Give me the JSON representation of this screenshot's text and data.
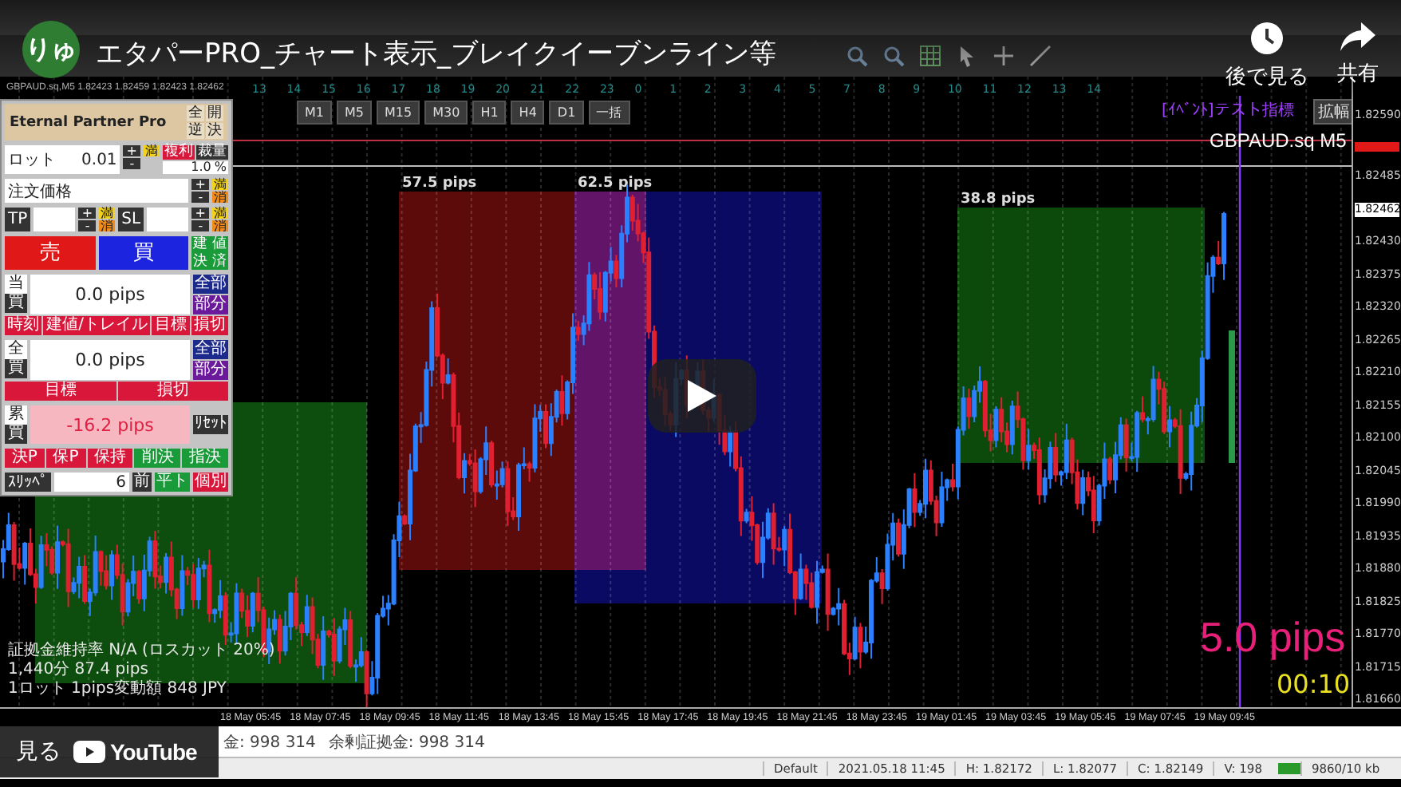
{
  "video": {
    "avatar": "りゅ",
    "title": "エタパーPRO_チャート表示_ブレイクイーブンライン等",
    "actions": [
      {
        "kind": "watch_later",
        "label": "後で見る"
      },
      {
        "kind": "share",
        "label": "共有"
      }
    ],
    "watch_on": "見る",
    "brand": "YouTube"
  },
  "chart": {
    "symbol_line": "GBPAUD.sq,M5 1.82423 1.82459 1.82423 1.82462",
    "hours": [
      "13",
      "14",
      "15",
      "16",
      "17",
      "18",
      "19",
      "20",
      "21",
      "22",
      "23",
      "0",
      "1",
      "2",
      "3",
      "4",
      "5",
      "7",
      "8",
      "9",
      "10",
      "11",
      "12",
      "13",
      "14"
    ],
    "timeframes": [
      {
        "label": "M1",
        "selected": false
      },
      {
        "label": "M5",
        "selected": false
      },
      {
        "label": "M15",
        "selected": false
      },
      {
        "label": "M30",
        "selected": false
      },
      {
        "label": "H1",
        "selected": false
      },
      {
        "label": "H4",
        "selected": false
      },
      {
        "label": "D1",
        "selected": false
      },
      {
        "label": "一括",
        "selected": false
      }
    ],
    "event_label": "[ｲﾍﾞﾝﾄ]テスト指標",
    "expand_button": "拡幅",
    "symbol_title": "GBPAUD.sq M5",
    "zones": [
      {
        "label": "57.5 pips",
        "color": "#5c0a0a"
      },
      {
        "label": "62.5 pips",
        "color": "#0a0a62"
      },
      {
        "label": "38.8 pips",
        "color": "#0b4a0b"
      },
      {
        "color": "#0d4d0d"
      }
    ],
    "info_lines": [
      "証拠金維持率 N/A (ロスカット 20%)",
      "1,440分 87.4 pips",
      "1ロット 1pips変動額 848 JPY"
    ],
    "pips_reading": "5.0 pips",
    "countdown": "00:10",
    "price_axis": [
      "1.82590",
      "1.82485",
      "1.82430",
      "1.82375",
      "1.82320",
      "1.82265",
      "1.82210",
      "1.82155",
      "1.82100",
      "1.82045",
      "1.81990",
      "1.81935",
      "1.81880",
      "1.81825",
      "1.81770",
      "1.81715",
      "1.81660"
    ],
    "current_price": "1.82462",
    "time_axis": [
      "18 May 05:45",
      "18 May 07:45",
      "18 May 09:45",
      "18 May 11:45",
      "18 May 13:45",
      "18 May 15:45",
      "18 May 17:45",
      "18 May 19:45",
      "18 May 21:45",
      "18 May 23:45",
      "19 May 01:45",
      "19 May 03:45",
      "19 May 05:45",
      "19 May 07:45",
      "19 May 09:45"
    ]
  },
  "panel": {
    "title": "Eternal Partner Pro",
    "header_buttons": [
      "全",
      "開",
      "逆",
      "決"
    ],
    "lot": {
      "label": "ロット",
      "value": "0.01",
      "stepper": [
        "+",
        "-"
      ],
      "max": "満",
      "compound": "複利",
      "discretion": "裁量",
      "percent": "1.0",
      "unit": "%"
    },
    "price": {
      "label": "注文価格",
      "stepper": [
        "+",
        "-"
      ],
      "max": "満",
      "clear": "消"
    },
    "stops": [
      {
        "label": "TP",
        "stepper": [
          "+",
          "-"
        ],
        "max": "満",
        "clear": "消"
      },
      {
        "label": "SL",
        "stepper": [
          "+",
          "-"
        ],
        "max": "満",
        "clear": "消"
      }
    ],
    "sell": "売",
    "buy": "買",
    "extra": [
      "建",
      "値",
      "決",
      "済"
    ],
    "sections": [
      {
        "head": "当",
        "side": "買",
        "value": "0.0 pips",
        "kind": "normal",
        "buttons": [
          {
            "label": "全部",
            "kind": "navy"
          },
          {
            "label": "部分",
            "kind": "purple"
          }
        ],
        "actions": [
          "時刻",
          "建値/トレイル",
          "目標",
          "損切"
        ]
      },
      {
        "head": "全",
        "side": "買",
        "value": "0.0 pips",
        "kind": "normal",
        "buttons": [
          {
            "label": "全部",
            "kind": "navy"
          },
          {
            "label": "部分",
            "kind": "purple"
          }
        ],
        "actions": [
          "目標",
          "損切"
        ]
      },
      {
        "head": "累",
        "side": "買",
        "value": "-16.2 pips",
        "kind": "loss",
        "buttons": [
          {
            "label": "ﾘｾｯﾄ",
            "kind": "dark"
          }
        ]
      }
    ],
    "bottom_buttons": [
      {
        "label": "決P",
        "kind": "red"
      },
      {
        "label": "保P",
        "kind": "red"
      },
      {
        "label": "保持",
        "kind": "red"
      },
      {
        "label": "削決",
        "kind": "green"
      },
      {
        "label": "指決",
        "kind": "green"
      }
    ],
    "slippage": {
      "label": "ｽﾘｯﾍﾟ",
      "value": "6"
    },
    "tail_buttons": [
      {
        "label": "前",
        "kind": "dark"
      },
      {
        "label": "平ト",
        "kind": "green"
      },
      {
        "label": "個別",
        "kind": "red"
      }
    ]
  },
  "account": [
    "金: 998 314",
    "余剰証拠金: 998 314"
  ],
  "status_bar": [
    "Default",
    "2021.05.18 11:45",
    "H: 1.82172",
    "L: 1.82077",
    "C: 1.82149",
    "V: 198",
    "9860/10 kb"
  ]
}
